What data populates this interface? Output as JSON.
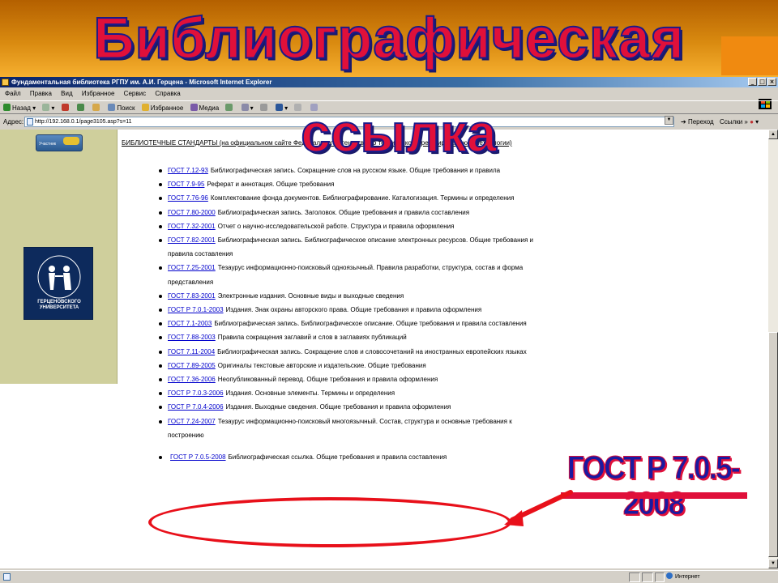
{
  "slide": {
    "title_line1": "Библиографическая",
    "title_line2": "ссылка",
    "callout": "ГОСТ Р 7.0.5-2008"
  },
  "window": {
    "title": "Фундаментальная библиотека РГПУ им. А.И. Герцена - Microsoft Internet Explorer",
    "buttons": [
      "_",
      "□",
      "×"
    ]
  },
  "menu": [
    "Файл",
    "Правка",
    "Вид",
    "Избранное",
    "Сервис",
    "Справка"
  ],
  "toolbar": {
    "back": "Назад",
    "search": "Поиск",
    "favorites": "Избранное",
    "media": "Медиа"
  },
  "address": {
    "label": "Адрес:",
    "url": "http://192.168.0.1/page3105.asp?s=11",
    "go": "Переход",
    "links": "Ссылки"
  },
  "sidebar": {
    "badge_text": "Участник",
    "emblem_text": "ГЕРЦЕНОВСКОГО УНИВЕРСИТЕТА"
  },
  "content": {
    "header": "БИБЛИОТЕЧНЫЕ СТАНДАРТЫ (на официальном сайте Федерального агентства по техническому регулированию и метрологии)",
    "items": [
      {
        "code": "ГОСТ 7.12-93",
        "text": "Библиографическая запись. Сокращение слов на русском языке. Общие требования и правила"
      },
      {
        "code": "ГОСТ 7.9-95",
        "text": "Реферат и аннотация. Общие требования"
      },
      {
        "code": "ГОСТ 7.76-96",
        "text": "Комплектование фонда документов. Библиографирование. Каталогизация. Термины и определения"
      },
      {
        "code": "ГОСТ 7.80-2000",
        "text": "Библиографическая запись. Заголовок. Общие требования и правила составления"
      },
      {
        "code": "ГОСТ 7.32-2001",
        "text": "Отчет о научно-исследовательской работе. Структура и правила оформления"
      },
      {
        "code": "ГОСТ 7.82-2001",
        "text": "Библиографическая запись. Библиографическое описание электронных ресурсов. Общие требования и правила составления"
      },
      {
        "code": "ГОСТ 7.25-2001",
        "text": "Тезаурус информационно-поисковый одноязычный. Правила разработки, структура, состав и форма представления"
      },
      {
        "code": "ГОСТ 7.83-2001",
        "text": "Электронные издания. Основные виды и выходные сведения"
      },
      {
        "code": "ГОСТ Р 7.0.1-2003",
        "text": "Издания. Знак охраны авторского права. Общие требования и правила оформления"
      },
      {
        "code": "ГОСТ 7.1-2003",
        "text": "Библиографическая запись. Библиографическое описание. Общие требования и правила составления"
      },
      {
        "code": "ГОСТ 7.88-2003",
        "text": "Правила сокращения заглавий и слов в заглавиях публикаций"
      },
      {
        "code": "ГОСТ 7.11-2004",
        "text": "Библиографическая запись. Сокращение слов и словосочетаний на иностранных европейских языках"
      },
      {
        "code": "ГОСТ 7.89-2005",
        "text": "Оригиналы текстовые авторские и издательские. Общие требования"
      },
      {
        "code": "ГОСТ 7.36-2006",
        "text": "Неопубликованный перевод. Общие требования и правила оформления"
      },
      {
        "code": "ГОСТ Р 7.0.3-2006",
        "text": "Издания. Основные элементы. Термины и определения"
      },
      {
        "code": "ГОСТ Р 7.0.4-2006",
        "text": "Издания. Выходные сведения. Общие требования и правила оформления"
      },
      {
        "code": "ГОСТ 7.24-2007",
        "text": "Тезаурус информационно-поисковый многоязычный. Состав, структура и основные требования к построению"
      },
      {
        "code": "ГОСТ Р 7.0.5-2008",
        "text": "Библиографическая ссылка. Общие требования и правила составления"
      }
    ]
  },
  "status": {
    "zone": "Интернет"
  },
  "colors": {
    "accent_red": "#e0103a",
    "title_blue": "#1a1a8a",
    "link": "#0000cc"
  }
}
